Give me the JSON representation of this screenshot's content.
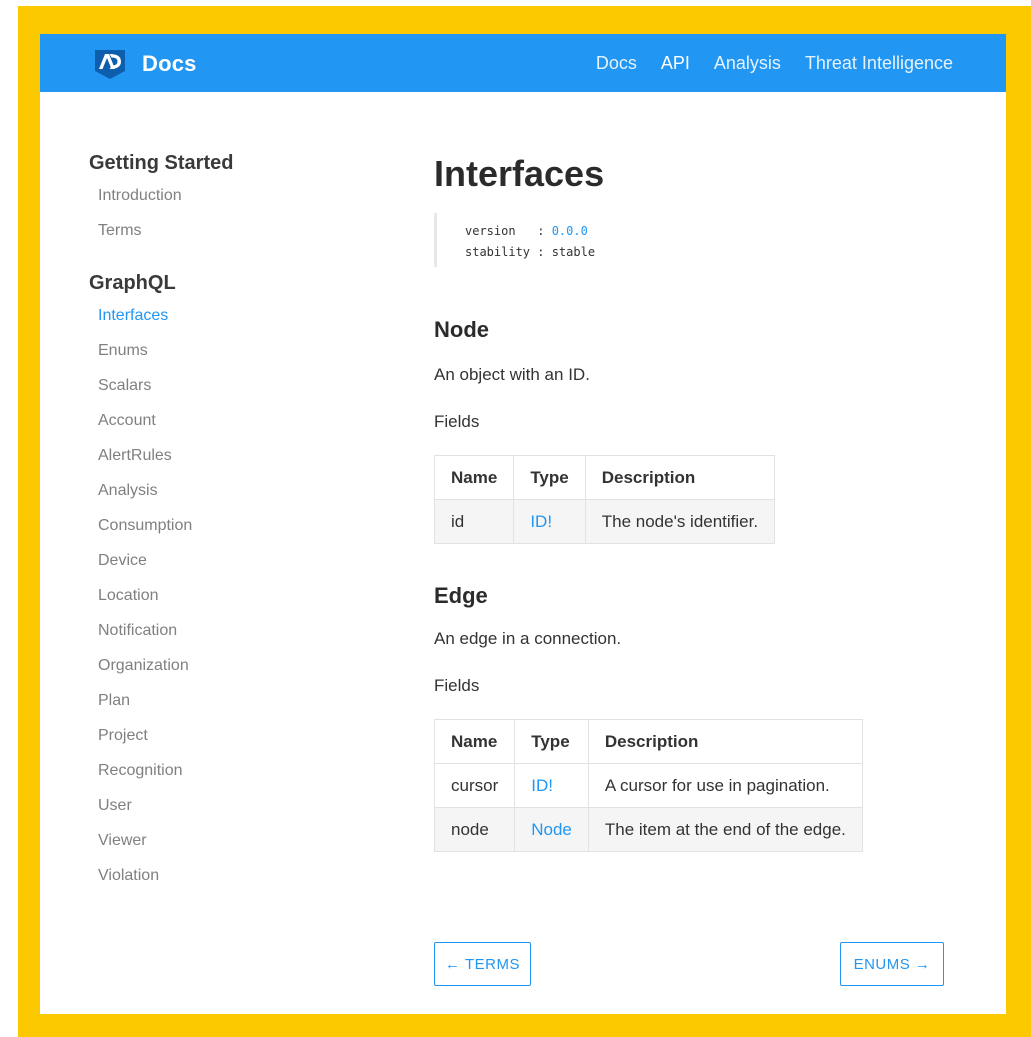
{
  "navbar": {
    "brand": "Docs",
    "links": [
      "Docs",
      "API",
      "Analysis",
      "Threat Intelligence"
    ]
  },
  "sidebar": {
    "sections": [
      {
        "title": "Getting Started",
        "items": [
          "Introduction",
          "Terms"
        ]
      },
      {
        "title": "GraphQL",
        "items": [
          "Interfaces",
          "Enums",
          "Scalars",
          "Account",
          "AlertRules",
          "Analysis",
          "Consumption",
          "Device",
          "Location",
          "Notification",
          "Organization",
          "Plan",
          "Project",
          "Recognition",
          "User",
          "Viewer",
          "Violation"
        ]
      }
    ],
    "active_item": "Interfaces"
  },
  "content": {
    "title": "Interfaces",
    "meta": {
      "version_label": "version   : ",
      "version_value": "0.0.0",
      "stability_label": "stability : ",
      "stability_value": "stable"
    },
    "sections": [
      {
        "name": "Node",
        "description": "An object with an ID.",
        "fields_label": "Fields",
        "columns": [
          "Name",
          "Type",
          "Description"
        ],
        "rows": [
          {
            "name": "id",
            "type": "ID!",
            "description": "The node's identifier."
          }
        ]
      },
      {
        "name": "Edge",
        "description": "An edge in a connection.",
        "fields_label": "Fields",
        "columns": [
          "Name",
          "Type",
          "Description"
        ],
        "rows": [
          {
            "name": "cursor",
            "type": "ID!",
            "description": "A cursor for use in pagination."
          },
          {
            "name": "node",
            "type": "Node",
            "description": "The item at the end of the edge."
          }
        ]
      }
    ]
  },
  "pager": {
    "prev_label": "← TERMS",
    "next_label": "ENUMS →"
  },
  "colors": {
    "frame": "#fcc800",
    "accent": "#2196f3"
  }
}
